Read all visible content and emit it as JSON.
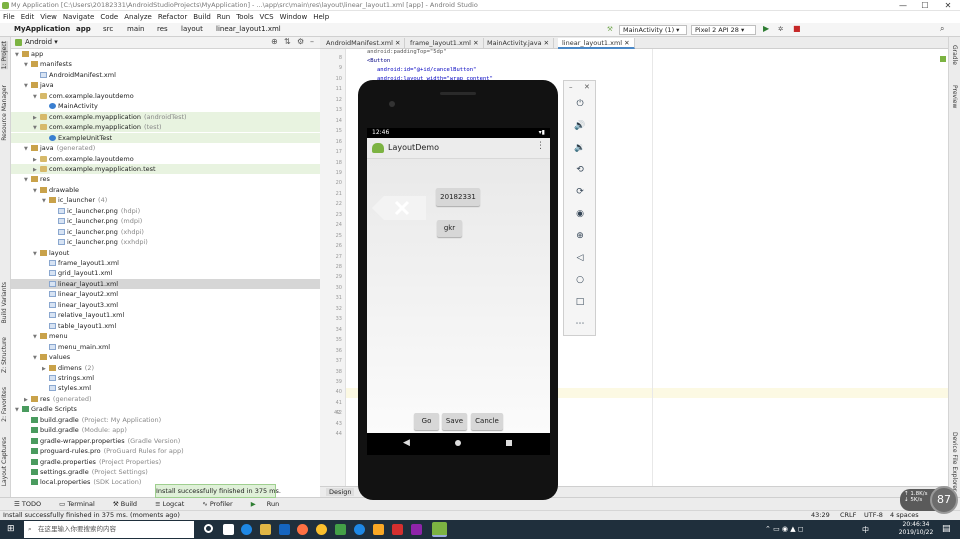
{
  "title_bar": {
    "title": "My Application [C:\\Users\\20182331\\AndroidStudioProjects\\MyApplication] - ...\\app\\src\\main\\res\\layout\\linear_layout1.xml [app] - Android Studio",
    "minimize": "—",
    "maximize": "☐",
    "close": "✕"
  },
  "menu": [
    "File",
    "Edit",
    "View",
    "Navigate",
    "Code",
    "Analyze",
    "Refactor",
    "Build",
    "Run",
    "Tools",
    "VCS",
    "Window",
    "Help"
  ],
  "breadcrumb": [
    "MyApplication",
    "app",
    "src",
    "main",
    "res",
    "layout",
    "linear_layout1.xml"
  ],
  "toolbar": {
    "run_config": "MainActivity (1) ▾",
    "device": "Pixel 2 API 28 ▾"
  },
  "project_pane": {
    "view": "Android ▾"
  },
  "tree": [
    {
      "label": "app",
      "type": "fold",
      "depth": 0,
      "open": true
    },
    {
      "label": "manifests",
      "type": "fold",
      "depth": 1,
      "open": true
    },
    {
      "label": "AndroidManifest.xml",
      "type": "file",
      "depth": 2
    },
    {
      "label": "java",
      "type": "fold",
      "depth": 1,
      "open": true
    },
    {
      "label": "com.example.layoutdemo",
      "type": "pkg",
      "depth": 2,
      "open": true
    },
    {
      "label": "MainActivity",
      "type": "cls",
      "depth": 3
    },
    {
      "label": "com.example.myapplication",
      "sub": "(androidTest)",
      "type": "pkg",
      "depth": 2,
      "hl": true
    },
    {
      "label": "com.example.myapplication",
      "sub": "(test)",
      "type": "pkg",
      "depth": 2,
      "open": true,
      "hl": true
    },
    {
      "label": "ExampleUnitTest",
      "type": "cls",
      "depth": 3,
      "hl": true
    },
    {
      "label": "java",
      "sub": "(generated)",
      "type": "fold",
      "depth": 1,
      "open": true
    },
    {
      "label": "com.example.layoutdemo",
      "type": "pkg",
      "depth": 2
    },
    {
      "label": "com.example.myapplication.test",
      "type": "pkg",
      "depth": 2,
      "hl": true
    },
    {
      "label": "res",
      "type": "fold",
      "depth": 1,
      "open": true
    },
    {
      "label": "drawable",
      "type": "fold",
      "depth": 2,
      "open": true
    },
    {
      "label": "ic_launcher",
      "sub": "(4)",
      "type": "fold",
      "depth": 3,
      "open": true
    },
    {
      "label": "ic_launcher.png",
      "sub": "(hdpi)",
      "type": "file",
      "depth": 4
    },
    {
      "label": "ic_launcher.png",
      "sub": "(mdpi)",
      "type": "file",
      "depth": 4
    },
    {
      "label": "ic_launcher.png",
      "sub": "(xhdpi)",
      "type": "file",
      "depth": 4
    },
    {
      "label": "ic_launcher.png",
      "sub": "(xxhdpi)",
      "type": "file",
      "depth": 4
    },
    {
      "label": "layout",
      "type": "fold",
      "depth": 2,
      "open": true
    },
    {
      "label": "frame_layout1.xml",
      "type": "file",
      "depth": 3
    },
    {
      "label": "grid_layout1.xml",
      "type": "file",
      "depth": 3
    },
    {
      "label": "linear_layout1.xml",
      "type": "file",
      "depth": 3,
      "sel": true
    },
    {
      "label": "linear_layout2.xml",
      "type": "file",
      "depth": 3
    },
    {
      "label": "linear_layout3.xml",
      "type": "file",
      "depth": 3
    },
    {
      "label": "relative_layout1.xml",
      "type": "file",
      "depth": 3
    },
    {
      "label": "table_layout1.xml",
      "type": "file",
      "depth": 3
    },
    {
      "label": "menu",
      "type": "fold",
      "depth": 2,
      "open": true
    },
    {
      "label": "menu_main.xml",
      "type": "file",
      "depth": 3
    },
    {
      "label": "values",
      "type": "fold",
      "depth": 2,
      "open": true
    },
    {
      "label": "dimens",
      "sub": "(2)",
      "type": "fold",
      "depth": 3
    },
    {
      "label": "strings.xml",
      "type": "file",
      "depth": 3
    },
    {
      "label": "styles.xml",
      "type": "file",
      "depth": 3
    },
    {
      "label": "res",
      "sub": "(generated)",
      "type": "fold",
      "depth": 1
    },
    {
      "label": "Gradle Scripts",
      "type": "grad",
      "depth": 0,
      "open": true
    },
    {
      "label": "build.gradle",
      "sub": "(Project: My Application)",
      "type": "grad",
      "depth": 1
    },
    {
      "label": "build.gradle",
      "sub": "(Module: app)",
      "type": "grad",
      "depth": 1
    },
    {
      "label": "gradle-wrapper.properties",
      "sub": "(Gradle Version)",
      "type": "grad",
      "depth": 1
    },
    {
      "label": "proguard-rules.pro",
      "sub": "(ProGuard Rules for app)",
      "type": "grad",
      "depth": 1
    },
    {
      "label": "gradle.properties",
      "sub": "(Project Properties)",
      "type": "grad",
      "depth": 1
    },
    {
      "label": "settings.gradle",
      "sub": "(Project Settings)",
      "type": "grad",
      "depth": 1
    },
    {
      "label": "local.properties",
      "sub": "(SDK Location)",
      "type": "grad",
      "depth": 1
    }
  ],
  "editor_tabs": [
    "AndroidManifest.xml",
    "frame_layout1.xml",
    "MainActivity.java",
    "linear_layout1.xml"
  ],
  "code_lines": [
    "android:paddingTop=\"5dp\"",
    "<Button",
    "android:id=\"@+id/cancelButton\"",
    "android:layout_width=\"wrap_content\""
  ],
  "line_numbers": [
    "8",
    "9",
    "10",
    "11",
    "12",
    "13",
    "14",
    "15",
    "16",
    "17",
    "18",
    "19",
    "20",
    "21",
    "22",
    "23",
    "24",
    "25",
    "26",
    "27",
    "28",
    "29",
    "30",
    "31",
    "32",
    "33",
    "34",
    "35",
    "36",
    "37",
    "38",
    "39",
    "40",
    "41",
    "42",
    "43",
    "44"
  ],
  "gutter_fold": "42",
  "design_tab": "Design",
  "left_tool_tabs": [
    "1: Project",
    "Resource Manager",
    "Build Variants",
    "Z: Structure",
    "2: Favorites",
    "Layout Captures"
  ],
  "right_tool_tabs": [
    "Gradle",
    "Preview",
    "Device File Explorer"
  ],
  "bottom_tools": [
    "TODO",
    "Terminal",
    "Build",
    "Logcat",
    "Profiler",
    "Run"
  ],
  "toast": "Install successfully finished in 375 ms.",
  "status": {
    "message": "Install successfully finished in 375 ms. (moments ago)",
    "position": "43:29",
    "line_ending": "CRLF",
    "encoding": "UTF-8",
    "indent": "4 spaces"
  },
  "perf": {
    "up": "↑ 1.8K/s",
    "down": "↓ 5K/s",
    "cpu": "87"
  },
  "phone": {
    "time": "12:46",
    "app_title": "LayoutDemo",
    "buttons_top": [
      "20182331",
      "gkr"
    ],
    "buttons_bottom": [
      "Go",
      "Save",
      "Cancle"
    ]
  },
  "taskbar": {
    "search_placeholder": "在这里输入你要搜索的内容",
    "time": "20:46:34",
    "date": "2019/10/22",
    "ime": "中"
  }
}
